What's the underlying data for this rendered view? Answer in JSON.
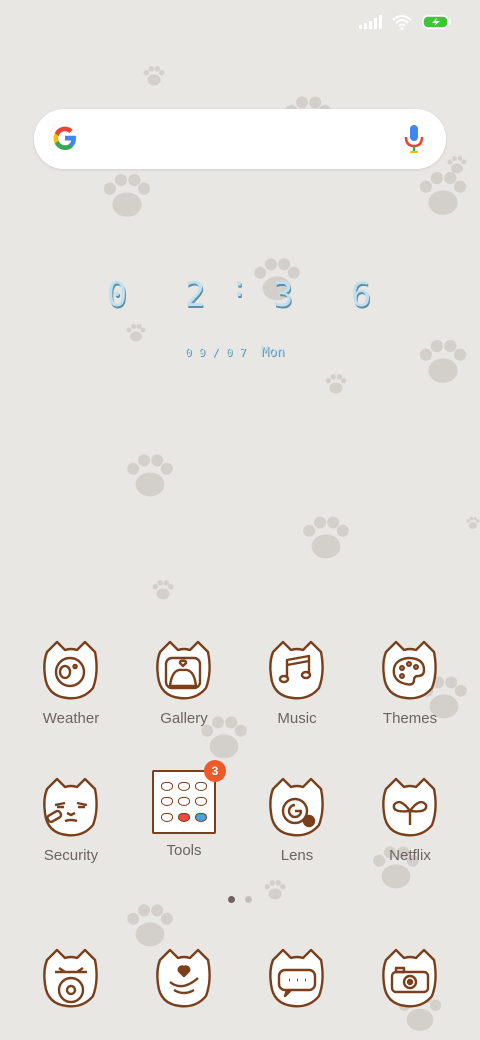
{
  "status_bar": {
    "signal_icon": "cellular-signal-icon",
    "wifi_icon": "wifi-icon",
    "battery_icon": "battery-charging-icon",
    "battery_color": "#3fc43a"
  },
  "search_bar": {
    "logo_icon": "google-g-icon",
    "mic_icon": "microphone-icon"
  },
  "clock": {
    "hour_tens": "0",
    "hour_ones": "2",
    "separator": ":",
    "minute_tens": "3",
    "minute_ones": "6",
    "date_text": "09/07",
    "weekday": "Mon"
  },
  "apps_row1": [
    {
      "label": "Weather",
      "icon": "cat-weather-icon"
    },
    {
      "label": "Gallery",
      "icon": "cat-gallery-icon"
    },
    {
      "label": "Music",
      "icon": "cat-music-icon"
    },
    {
      "label": "Themes",
      "icon": "cat-themes-icon"
    }
  ],
  "apps_row2": [
    {
      "label": "Security",
      "icon": "cat-security-icon"
    },
    {
      "label": "Tools",
      "icon": "folder-icon",
      "badge": "3"
    },
    {
      "label": "Lens",
      "icon": "cat-lens-icon"
    },
    {
      "label": "Netflix",
      "icon": "cat-netflix-icon"
    }
  ],
  "page_indicator": {
    "pages": 2,
    "current": 1
  },
  "dock": [
    {
      "icon": "cat-phone-icon"
    },
    {
      "icon": "cat-contacts-icon"
    },
    {
      "icon": "cat-messages-icon"
    },
    {
      "icon": "cat-camera-icon"
    }
  ],
  "colors": {
    "background": "#e9e7e4",
    "icon_stroke": "#7a3f1b",
    "clock_fill": "#bfe0ee",
    "clock_shadow": "#5c8fa8",
    "badge": "#f05a28"
  }
}
